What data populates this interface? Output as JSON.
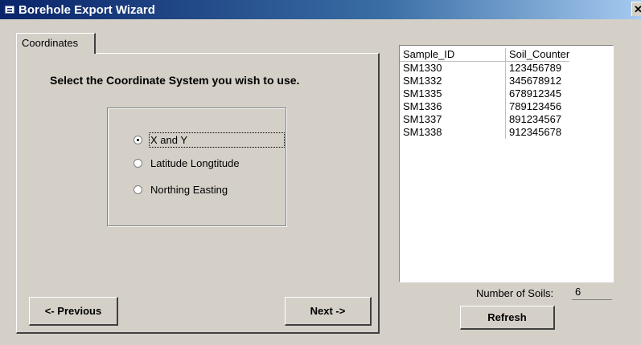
{
  "window": {
    "title": "Borehole Export Wizard",
    "close_label": "✕"
  },
  "tabs": [
    {
      "label": "Coordinates",
      "active": true
    }
  ],
  "coordinates": {
    "instruction": "Select the Coordinate System you wish to use.",
    "options": [
      {
        "label": "X and Y",
        "selected": true
      },
      {
        "label": "Latitude Longtitude",
        "selected": false
      },
      {
        "label": "Northing Easting",
        "selected": false
      }
    ]
  },
  "navigation": {
    "previous_label": "<- Previous",
    "next_label": "Next ->"
  },
  "soils_list": {
    "columns": [
      "Sample_ID",
      "Soil_Counter"
    ],
    "rows": [
      [
        "SM1330",
        "123456789"
      ],
      [
        "SM1332",
        "345678912"
      ],
      [
        "SM1335",
        "678912345"
      ],
      [
        "SM1336",
        "789123456"
      ],
      [
        "SM1337",
        "891234567"
      ],
      [
        "SM1338",
        "912345678"
      ]
    ],
    "count_label": "Number of Soils:",
    "count_value": "6",
    "refresh_label": "Refresh"
  },
  "colors": {
    "title_gradient_start": "#0a246a",
    "title_gradient_end": "#a6caf0",
    "face": "#d4d0c8"
  }
}
